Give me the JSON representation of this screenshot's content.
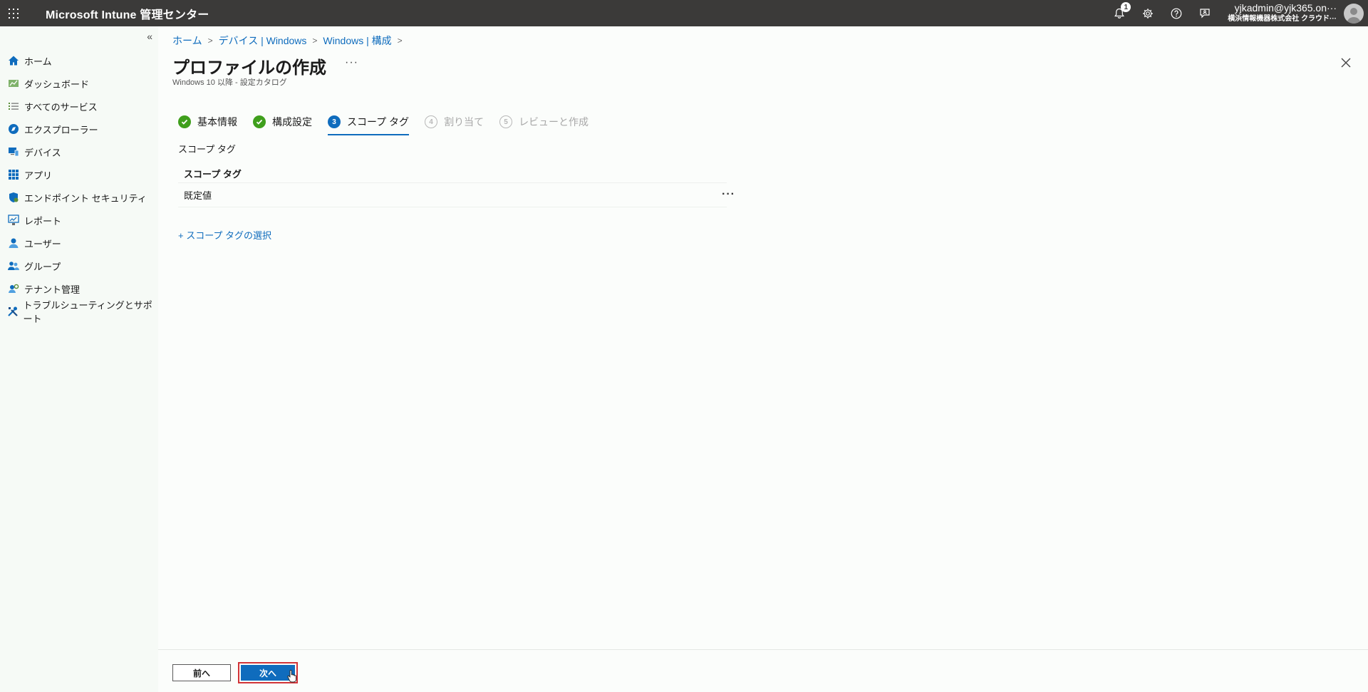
{
  "topbar": {
    "app_title": "Microsoft Intune 管理センター",
    "notification_count": "1",
    "account_user": "yjkadmin@yjk365.on···",
    "account_org": "横浜情報機器株式会社 クラウド···"
  },
  "sidebar": {
    "collapse_label": "«",
    "items": [
      {
        "label": "ホーム",
        "icon": "home-icon"
      },
      {
        "label": "ダッシュボード",
        "icon": "dashboard-icon"
      },
      {
        "label": "すべてのサービス",
        "icon": "list-icon"
      },
      {
        "label": "エクスプローラー",
        "icon": "explorer-icon"
      },
      {
        "label": "デバイス",
        "icon": "devices-icon"
      },
      {
        "label": "アプリ",
        "icon": "apps-icon"
      },
      {
        "label": "エンドポイント セキュリティ",
        "icon": "shield-icon"
      },
      {
        "label": "レポート",
        "icon": "reports-icon"
      },
      {
        "label": "ユーザー",
        "icon": "user-icon"
      },
      {
        "label": "グループ",
        "icon": "group-icon"
      },
      {
        "label": "テナント管理",
        "icon": "tenant-icon"
      },
      {
        "label": "トラブルシューティングとサポート",
        "icon": "tools-icon"
      }
    ]
  },
  "breadcrumb": [
    "ホーム",
    "デバイス | Windows",
    "Windows | 構成"
  ],
  "page": {
    "title": "プロファイルの作成",
    "more": "···",
    "subtitle": "Windows 10 以降 - 設定カタログ"
  },
  "steps": [
    {
      "label": "基本情報",
      "state": "done",
      "number": "1"
    },
    {
      "label": "構成設定",
      "state": "done",
      "number": "2"
    },
    {
      "label": "スコープ タグ",
      "state": "current",
      "number": "3"
    },
    {
      "label": "割り当て",
      "state": "pending",
      "number": "4"
    },
    {
      "label": "レビューと作成",
      "state": "pending",
      "number": "5"
    }
  ],
  "scope": {
    "section_label": "スコープ タグ",
    "column_header": "スコープ タグ",
    "rows": [
      "既定値"
    ],
    "row_more": "···",
    "add_link": "+ スコープ タグの選択"
  },
  "footer": {
    "prev_label": "前へ",
    "next_label": "次へ"
  },
  "colors": {
    "topbar": "#3b3a39",
    "accent": "#0f6cbd",
    "success": "#3f9f1c",
    "highlight": "#d13438"
  }
}
